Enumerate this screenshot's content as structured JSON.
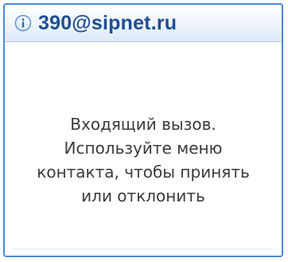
{
  "window": {
    "title": "390@sipnet.ru",
    "icon": "info-icon",
    "accent_color": "#1d4e92",
    "border_color": "#4a8ad6"
  },
  "message": {
    "lines": [
      "Входящий вызов.",
      "Используйте меню",
      "контакта, чтобы принять",
      "или отклонить"
    ]
  }
}
